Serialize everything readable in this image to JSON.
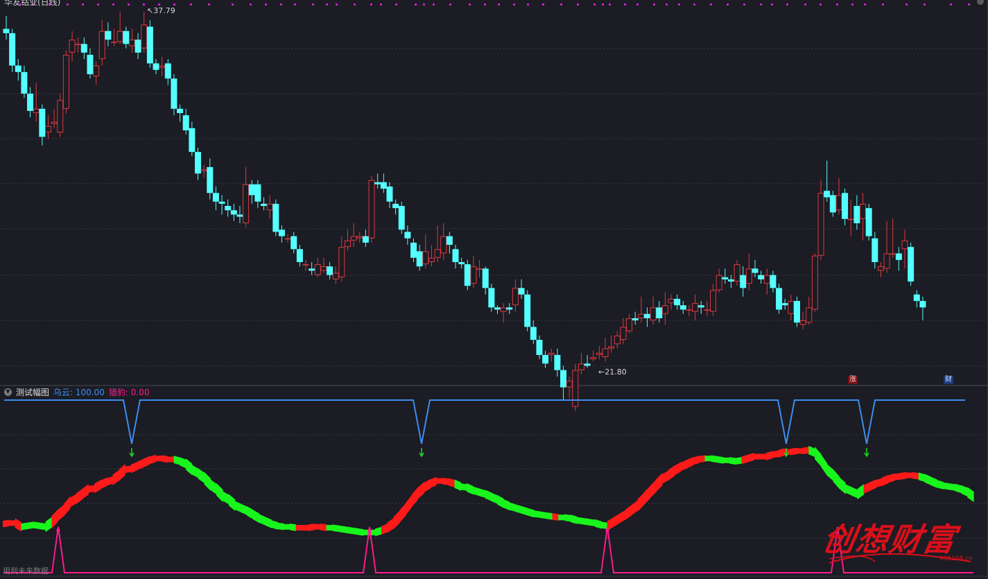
{
  "main_panel": {
    "title": "华友钴业(日线)",
    "high_marker": "37.79",
    "low_marker": "21.80",
    "badge_rise": "涨",
    "badge_finance": "财"
  },
  "sub_panel": {
    "name": "测试幅图",
    "wuyun_label": "乌云: 100.00",
    "liebao_label": "猎豹: 0.00",
    "bottom_note": "用到未来数据"
  },
  "watermark": {
    "text": "创想财富",
    "url": "995168.cn"
  },
  "colors": {
    "background": "#1b1c24",
    "candle_up": "#e0393e",
    "candle_down": "#54ffff",
    "band_up": "#ff1a1a",
    "band_down": "#19f51c",
    "blue_line": "#3d8ef0",
    "pink_line": "#ff1a8c",
    "marker_dots": "#d21ed2",
    "arrow_green": "#19e019"
  },
  "icons": [
    "chevron-down-icon",
    "arrow-down-icon",
    "arrow-left-icon"
  ],
  "candles": [
    [
      37.0,
      36.8,
      37.6,
      36.5
    ],
    [
      36.8,
      35.3,
      37.0,
      35.0
    ],
    [
      35.3,
      35.0,
      35.6,
      34.6
    ],
    [
      35.0,
      34.0,
      35.3,
      33.8
    ],
    [
      34.0,
      33.2,
      34.3,
      32.9
    ],
    [
      33.1,
      33.3,
      34.5,
      32.7
    ],
    [
      33.3,
      32.0,
      33.5,
      31.6
    ],
    [
      32.2,
      32.5,
      33.0,
      31.9
    ],
    [
      32.6,
      32.7,
      33.3,
      32.4
    ],
    [
      32.2,
      33.7,
      34.0,
      32.0
    ],
    [
      33.3,
      35.8,
      36.0,
      33.1
    ],
    [
      35.9,
      36.5,
      36.9,
      35.5
    ],
    [
      36.3,
      36.3,
      36.6,
      35.9
    ],
    [
      36.3,
      35.9,
      36.6,
      35.6
    ],
    [
      35.8,
      34.9,
      36.1,
      34.7
    ],
    [
      34.8,
      35.3,
      35.5,
      34.4
    ],
    [
      35.6,
      36.9,
      37.4,
      35.3
    ],
    [
      36.9,
      36.5,
      37.3,
      36.2
    ],
    [
      36.4,
      36.4,
      37.0,
      36.2
    ],
    [
      36.4,
      36.9,
      37.8,
      36.3
    ],
    [
      36.9,
      36.3,
      37.1,
      36.1
    ],
    [
      36.2,
      36.5,
      37.0,
      35.9
    ],
    [
      36.5,
      35.9,
      36.8,
      35.6
    ],
    [
      36.1,
      37.2,
      37.8,
      35.9
    ],
    [
      37.1,
      35.4,
      37.4,
      35.2
    ],
    [
      35.4,
      35.1,
      35.6,
      34.9
    ],
    [
      35.2,
      35.3,
      35.7,
      34.8
    ],
    [
      35.4,
      34.7,
      35.6,
      34.4
    ],
    [
      34.7,
      33.3,
      34.9,
      33.0
    ],
    [
      33.3,
      33.1,
      33.5,
      32.7
    ],
    [
      33.0,
      32.3,
      33.3,
      32.1
    ],
    [
      32.4,
      31.3,
      32.7,
      31.1
    ],
    [
      31.3,
      30.3,
      31.5,
      30.0
    ],
    [
      30.4,
      30.5,
      30.7,
      30.1
    ],
    [
      30.6,
      29.4,
      31.0,
      29.1
    ],
    [
      29.4,
      29.0,
      29.7,
      28.6
    ],
    [
      29.0,
      28.9,
      29.3,
      28.4
    ],
    [
      28.8,
      28.6,
      29.1,
      28.3
    ],
    [
      28.6,
      28.4,
      28.9,
      28.1
    ],
    [
      28.4,
      28.3,
      28.8,
      28.0
    ],
    [
      28.0,
      29.8,
      30.6,
      27.8
    ],
    [
      29.8,
      29.3,
      30.0,
      28.9
    ],
    [
      29.8,
      29.0,
      30.0,
      28.7
    ],
    [
      28.9,
      28.8,
      29.2,
      28.6
    ],
    [
      28.6,
      28.9,
      29.3,
      28.2
    ],
    [
      28.9,
      27.6,
      29.1,
      27.4
    ],
    [
      27.7,
      27.4,
      27.9,
      27.1
    ],
    [
      27.3,
      27.3,
      27.5,
      27.1
    ],
    [
      27.4,
      26.8,
      27.6,
      26.6
    ],
    [
      26.8,
      26.2,
      27.0,
      26.0
    ],
    [
      26.1,
      26.1,
      26.3,
      25.8
    ],
    [
      25.9,
      25.8,
      26.2,
      25.6
    ],
    [
      25.6,
      26.1,
      26.4,
      25.5
    ],
    [
      25.8,
      26.0,
      26.4,
      25.7
    ],
    [
      26.0,
      25.6,
      26.2,
      25.4
    ],
    [
      25.4,
      25.7,
      26.0,
      25.2
    ],
    [
      25.5,
      26.9,
      27.4,
      25.3
    ],
    [
      26.9,
      27.2,
      27.7,
      26.7
    ],
    [
      27.2,
      27.4,
      28.0,
      26.9
    ],
    [
      27.3,
      27.4,
      27.6,
      27.1
    ],
    [
      27.4,
      27.1,
      27.7,
      26.9
    ],
    [
      27.3,
      30.0,
      30.2,
      27.1
    ],
    [
      29.9,
      29.8,
      30.3,
      29.6
    ],
    [
      29.9,
      29.6,
      30.3,
      29.4
    ],
    [
      29.7,
      29.0,
      29.9,
      28.7
    ],
    [
      28.9,
      28.7,
      29.1,
      28.4
    ],
    [
      28.8,
      27.7,
      29.0,
      27.5
    ],
    [
      27.6,
      27.3,
      27.9,
      27.0
    ],
    [
      27.1,
      26.4,
      27.3,
      26.2
    ],
    [
      26.7,
      26.0,
      27.0,
      25.8
    ],
    [
      26.1,
      26.7,
      27.5,
      25.9
    ],
    [
      26.2,
      26.4,
      27.0,
      26.0
    ],
    [
      26.4,
      26.8,
      27.9,
      26.2
    ],
    [
      26.6,
      27.4,
      28.0,
      26.3
    ],
    [
      27.4,
      27.0,
      27.6,
      26.6
    ],
    [
      26.8,
      26.2,
      27.0,
      25.9
    ],
    [
      26.2,
      26.1,
      26.4,
      25.9
    ],
    [
      26.1,
      25.1,
      26.3,
      24.9
    ],
    [
      25.2,
      26.0,
      26.5,
      25.0
    ],
    [
      25.9,
      25.9,
      26.3,
      25.5
    ],
    [
      25.9,
      25.0,
      26.0,
      24.7
    ],
    [
      25.0,
      24.1,
      25.2,
      23.9
    ],
    [
      24.1,
      24.0,
      24.2,
      23.8
    ],
    [
      23.9,
      24.1,
      24.3,
      23.4
    ],
    [
      24.1,
      24.0,
      24.3,
      23.8
    ],
    [
      24.2,
      25.0,
      25.4,
      23.9
    ],
    [
      25.0,
      24.7,
      25.4,
      24.5
    ],
    [
      24.7,
      23.2,
      24.9,
      23.0
    ],
    [
      23.2,
      22.6,
      23.5,
      22.4
    ],
    [
      22.6,
      21.9,
      22.8,
      21.7
    ],
    [
      21.9,
      21.5,
      22.1,
      21.3
    ],
    [
      21.9,
      22.0,
      22.2,
      21.6
    ],
    [
      21.9,
      21.2,
      22.2,
      20.9
    ],
    [
      21.2,
      20.4,
      21.4,
      19.8
    ],
    [
      20.4,
      20.7,
      20.9,
      19.9
    ],
    [
      19.5,
      21.2,
      21.5,
      19.3
    ],
    [
      21.2,
      21.5,
      22.0,
      21.0
    ],
    [
      21.5,
      21.4,
      21.9,
      21.3
    ],
    [
      21.7,
      21.8,
      22.1,
      21.6
    ],
    [
      21.9,
      22.0,
      22.3,
      21.7
    ],
    [
      21.8,
      22.2,
      22.7,
      21.6
    ],
    [
      22.2,
      22.3,
      22.8,
      22.0
    ],
    [
      22.4,
      22.8,
      23.0,
      22.2
    ],
    [
      22.6,
      23.2,
      23.6,
      22.4
    ],
    [
      23.0,
      23.6,
      23.8,
      22.9
    ],
    [
      23.6,
      23.5,
      23.9,
      23.3
    ],
    [
      23.6,
      23.8,
      24.6,
      23.4
    ],
    [
      23.8,
      23.6,
      24.1,
      23.2
    ],
    [
      23.5,
      24.1,
      24.6,
      23.3
    ],
    [
      24.1,
      23.6,
      24.4,
      23.4
    ],
    [
      23.8,
      24.2,
      24.8,
      23.3
    ],
    [
      24.3,
      24.5,
      24.7,
      24.0
    ],
    [
      24.5,
      24.2,
      24.7,
      24.0
    ],
    [
      24.2,
      24.0,
      24.4,
      23.8
    ],
    [
      24.0,
      24.0,
      24.2,
      23.7
    ],
    [
      23.9,
      24.3,
      24.7,
      23.5
    ],
    [
      24.2,
      24.1,
      24.4,
      23.8
    ],
    [
      24.0,
      24.0,
      24.4,
      23.7
    ],
    [
      23.9,
      24.9,
      25.2,
      23.7
    ],
    [
      24.9,
      25.6,
      25.9,
      24.8
    ],
    [
      25.5,
      25.4,
      25.9,
      25.2
    ],
    [
      25.4,
      25.3,
      25.6,
      25.0
    ],
    [
      25.3,
      26.1,
      26.3,
      25.1
    ],
    [
      25.6,
      25.0,
      26.0,
      24.6
    ],
    [
      25.2,
      25.9,
      26.6,
      24.9
    ],
    [
      25.9,
      25.7,
      26.3,
      25.5
    ],
    [
      25.6,
      25.4,
      25.8,
      25.2
    ],
    [
      25.2,
      25.6,
      25.9,
      24.7
    ],
    [
      25.6,
      25.0,
      25.8,
      24.8
    ],
    [
      25.0,
      24.0,
      25.2,
      23.8
    ],
    [
      24.3,
      24.2,
      24.5,
      24.0
    ],
    [
      23.8,
      24.4,
      24.7,
      23.5
    ],
    [
      24.4,
      23.4,
      24.6,
      23.2
    ],
    [
      23.3,
      23.5,
      23.9,
      23.1
    ],
    [
      23.4,
      24.1,
      24.6,
      23.3
    ],
    [
      24.0,
      26.5,
      26.6,
      23.9
    ],
    [
      26.5,
      29.4,
      30.0,
      26.3
    ],
    [
      29.5,
      29.2,
      30.9,
      29.0
    ],
    [
      29.3,
      28.5,
      29.5,
      28.3
    ],
    [
      28.6,
      29.3,
      30.1,
      28.4
    ],
    [
      29.4,
      28.2,
      29.6,
      27.9
    ],
    [
      28.2,
      28.2,
      29.1,
      27.4
    ],
    [
      28.8,
      28.0,
      29.3,
      27.7
    ],
    [
      28.2,
      28.9,
      29.4,
      27.2
    ],
    [
      28.7,
      27.4,
      28.9,
      27.2
    ],
    [
      27.3,
      26.2,
      27.6,
      25.9
    ],
    [
      25.8,
      26.0,
      26.2,
      25.5
    ],
    [
      25.9,
      26.6,
      28.1,
      25.7
    ],
    [
      26.6,
      26.6,
      28.2,
      26.4
    ],
    [
      26.6,
      26.3,
      26.9,
      25.8
    ],
    [
      26.8,
      27.2,
      27.7,
      25.9
    ],
    [
      26.9,
      25.3,
      27.1,
      25.1
    ],
    [
      24.7,
      24.4,
      24.9,
      24.1
    ],
    [
      24.4,
      24.1,
      24.6,
      23.5
    ]
  ],
  "band_data": [
    [
      18,
      0
    ],
    [
      19,
      0
    ],
    [
      19,
      0
    ],
    [
      15,
      1
    ],
    [
      16,
      1
    ],
    [
      17,
      1
    ],
    [
      16,
      1
    ],
    [
      15,
      1
    ],
    [
      20,
      0
    ],
    [
      27,
      0
    ],
    [
      33,
      0
    ],
    [
      41,
      0
    ],
    [
      45,
      0
    ],
    [
      50,
      0
    ],
    [
      55,
      0
    ],
    [
      56,
      0
    ],
    [
      60,
      0
    ],
    [
      63,
      0
    ],
    [
      65,
      0
    ],
    [
      70,
      0
    ],
    [
      76,
      0
    ],
    [
      77,
      0
    ],
    [
      80,
      0
    ],
    [
      83,
      0
    ],
    [
      86,
      0
    ],
    [
      88,
      0
    ],
    [
      88,
      0
    ],
    [
      87,
      0
    ],
    [
      87,
      1
    ],
    [
      85,
      1
    ],
    [
      82,
      1
    ],
    [
      76,
      1
    ],
    [
      72,
      1
    ],
    [
      67,
      1
    ],
    [
      60,
      1
    ],
    [
      55,
      1
    ],
    [
      48,
      1
    ],
    [
      44,
      1
    ],
    [
      38,
      1
    ],
    [
      35,
      1
    ],
    [
      32,
      1
    ],
    [
      28,
      1
    ],
    [
      24,
      1
    ],
    [
      21,
      1
    ],
    [
      18,
      1
    ],
    [
      16,
      1
    ],
    [
      15,
      1
    ],
    [
      15,
      1
    ],
    [
      14,
      0
    ],
    [
      14,
      0
    ],
    [
      14,
      0
    ],
    [
      15,
      0
    ],
    [
      15,
      0
    ],
    [
      14,
      1
    ],
    [
      14,
      1
    ],
    [
      13,
      1
    ],
    [
      12,
      1
    ],
    [
      11,
      1
    ],
    [
      10,
      1
    ],
    [
      9,
      1
    ],
    [
      9,
      1
    ],
    [
      9,
      1
    ],
    [
      11,
      0
    ],
    [
      14,
      0
    ],
    [
      19,
      0
    ],
    [
      26,
      0
    ],
    [
      34,
      0
    ],
    [
      43,
      0
    ],
    [
      51,
      0
    ],
    [
      57,
      0
    ],
    [
      61,
      0
    ],
    [
      64,
      0
    ],
    [
      64,
      0
    ],
    [
      63,
      0
    ],
    [
      61,
      1
    ],
    [
      58,
      1
    ],
    [
      57,
      1
    ],
    [
      54,
      1
    ],
    [
      52,
      1
    ],
    [
      50,
      1
    ],
    [
      47,
      1
    ],
    [
      44,
      1
    ],
    [
      40,
      1
    ],
    [
      37,
      1
    ],
    [
      35,
      1
    ],
    [
      33,
      1
    ],
    [
      31,
      1
    ],
    [
      29,
      1
    ],
    [
      28,
      1
    ],
    [
      27,
      1
    ],
    [
      26,
      0
    ],
    [
      25,
      1
    ],
    [
      25,
      1
    ],
    [
      24,
      1
    ],
    [
      22,
      1
    ],
    [
      21,
      1
    ],
    [
      20,
      1
    ],
    [
      19,
      1
    ],
    [
      17,
      1
    ],
    [
      16,
      0
    ],
    [
      20,
      0
    ],
    [
      24,
      0
    ],
    [
      28,
      0
    ],
    [
      33,
      0
    ],
    [
      38,
      0
    ],
    [
      45,
      0
    ],
    [
      52,
      0
    ],
    [
      59,
      0
    ],
    [
      66,
      0
    ],
    [
      70,
      0
    ],
    [
      75,
      0
    ],
    [
      79,
      0
    ],
    [
      82,
      0
    ],
    [
      85,
      0
    ],
    [
      87,
      0
    ],
    [
      88,
      1
    ],
    [
      88,
      1
    ],
    [
      87,
      1
    ],
    [
      86,
      1
    ],
    [
      86,
      1
    ],
    [
      85,
      1
    ],
    [
      86,
      0
    ],
    [
      88,
      0
    ],
    [
      90,
      0
    ],
    [
      90,
      0
    ],
    [
      90,
      0
    ],
    [
      92,
      0
    ],
    [
      93,
      0
    ],
    [
      95,
      0
    ],
    [
      95,
      0
    ],
    [
      96,
      0
    ],
    [
      96,
      0
    ],
    [
      97,
      1
    ],
    [
      94,
      1
    ],
    [
      86,
      1
    ],
    [
      76,
      1
    ],
    [
      70,
      1
    ],
    [
      62,
      1
    ],
    [
      56,
      1
    ],
    [
      53,
      1
    ],
    [
      50,
      1
    ],
    [
      55,
      0
    ],
    [
      58,
      0
    ],
    [
      61,
      0
    ],
    [
      63,
      0
    ],
    [
      66,
      0
    ],
    [
      68,
      0
    ],
    [
      69,
      0
    ],
    [
      70,
      0
    ],
    [
      70,
      0
    ],
    [
      69,
      1
    ],
    [
      67,
      1
    ],
    [
      64,
      1
    ],
    [
      61,
      1
    ],
    [
      59,
      1
    ],
    [
      58,
      1
    ],
    [
      57,
      1
    ],
    [
      55,
      1
    ],
    [
      52,
      1
    ],
    [
      47,
      1
    ]
  ]
}
